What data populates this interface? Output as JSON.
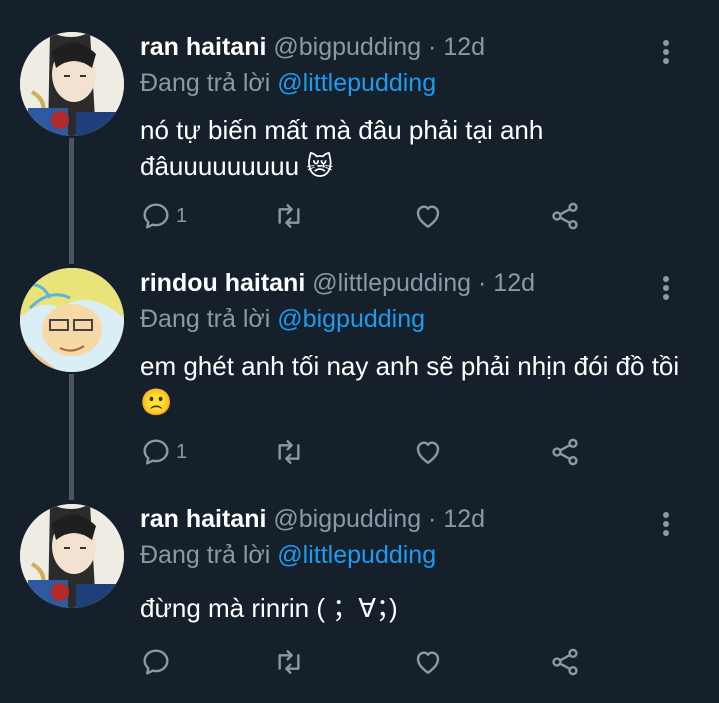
{
  "tweets": [
    {
      "name": "ran haitani",
      "handle": "@bigpudding",
      "time": "· 12d",
      "reply_prefix": "Đang trả lời",
      "reply_to": "@littlepudding",
      "text": "nó tự biến mất mà đâu phải tại anh đâuuuuuuuuu 😿",
      "reply_count": "1",
      "retweet_count": "",
      "like_count": ""
    },
    {
      "name": "rindou haitani",
      "handle": "@littlepudding",
      "time": "· 12d",
      "reply_prefix": "Đang trả lời",
      "reply_to": "@bigpudding",
      "text": "em ghét anh tối nay anh sẽ phải nhịn đói đồ tồi 🙁",
      "reply_count": "1",
      "retweet_count": "",
      "like_count": ""
    },
    {
      "name": "ran haitani",
      "handle": "@bigpudding",
      "time": "· 12d",
      "reply_prefix": "Đang trả lời",
      "reply_to": "@littlepudding",
      "text": "đừng mà rinrin ( ；∀；)",
      "reply_count": "",
      "retweet_count": "",
      "like_count": ""
    }
  ],
  "icons": {
    "reply": "reply-icon",
    "retweet": "retweet-icon",
    "like": "heart-icon",
    "share": "share-icon",
    "more": "more-icon"
  },
  "colors": {
    "background": "#15202b",
    "secondary_text": "#8b98a5",
    "mention": "#1d9bf0",
    "thread_line": "#4a5561"
  }
}
